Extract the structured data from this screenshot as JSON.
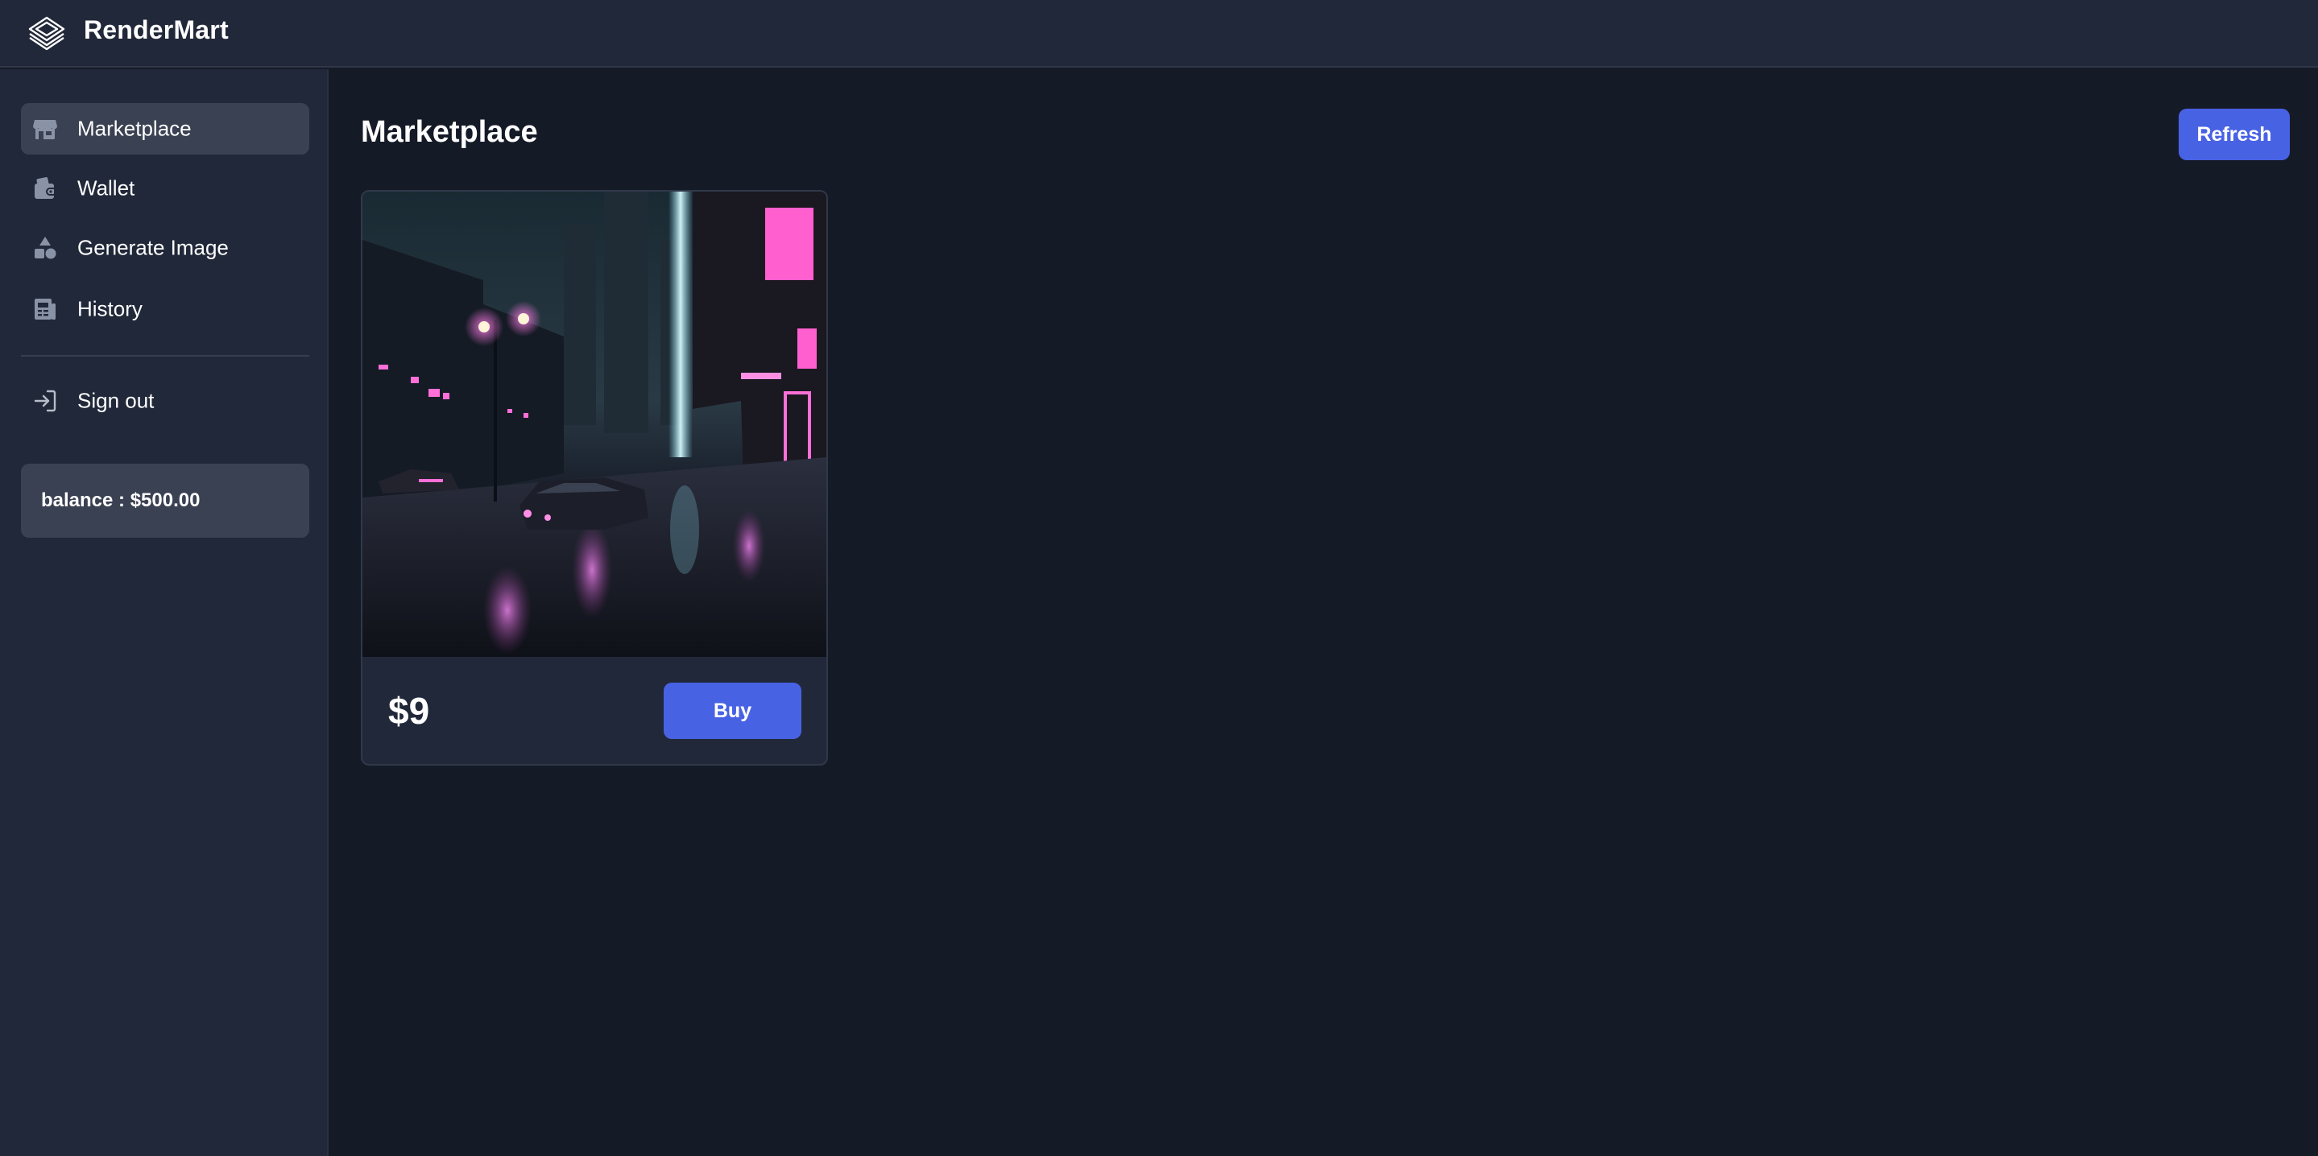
{
  "header": {
    "brand_name": "RenderMart",
    "brand_icon": "layers-icon"
  },
  "sidebar": {
    "items": [
      {
        "label": "Marketplace",
        "icon": "storefront-icon",
        "active": true
      },
      {
        "label": "Wallet",
        "icon": "wallet-icon",
        "active": false
      },
      {
        "label": "Generate Image",
        "icon": "shapes-icon",
        "active": false
      },
      {
        "label": "History",
        "icon": "newspaper-icon",
        "active": false
      }
    ],
    "sign_out": {
      "label": "Sign out",
      "icon": "sign-in-arrow-icon"
    },
    "balance_text": "balance : $500.00"
  },
  "main": {
    "title": "Marketplace",
    "refresh_label": "Refresh",
    "listings": [
      {
        "price": "$9",
        "buy_label": "Buy",
        "image": "neon cyberpunk street at night"
      }
    ]
  },
  "colors": {
    "background": "#151a27",
    "panel": "#212839",
    "active_item": "#3a4152",
    "accent": "#4862e4",
    "text": "#ffffff"
  }
}
